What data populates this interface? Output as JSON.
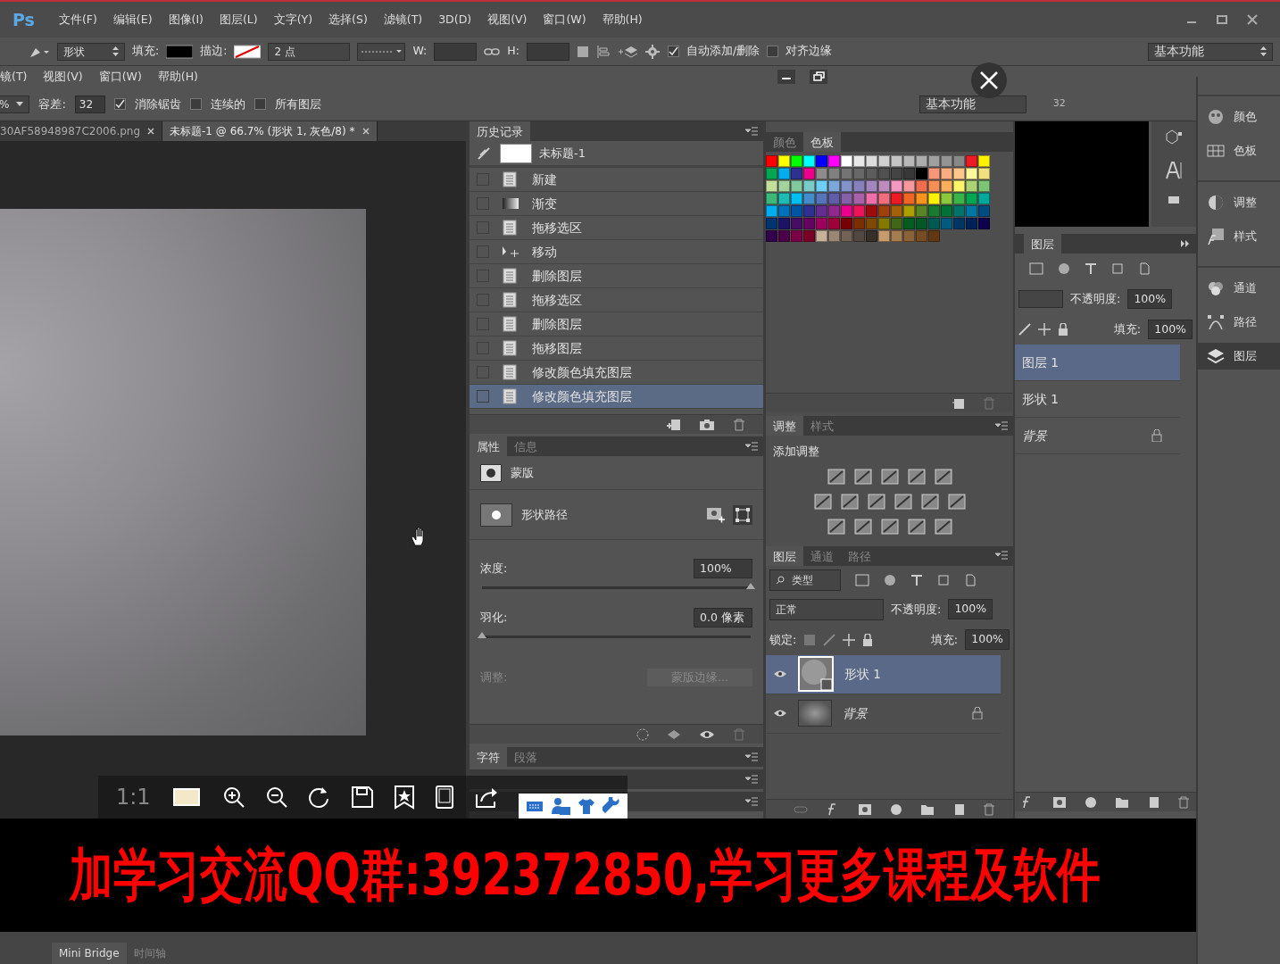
{
  "menu_bar": {
    "logo": "Ps",
    "items": [
      "文件(F)",
      "编辑(E)",
      "图像(I)",
      "图层(L)",
      "文字(Y)",
      "选择(S)",
      "滤镜(T)",
      "3D(D)",
      "视图(V)",
      "窗口(W)",
      "帮助(H)"
    ]
  },
  "options_bar": {
    "tool_mode": "形状",
    "fill_label": "填充:",
    "stroke_label": "描边:",
    "stroke_width": "2 点",
    "w_label": "W:",
    "h_label": "H:",
    "checks": [
      {
        "label": "自动添加/删除",
        "checked": true
      },
      {
        "label": "对齐边缘",
        "checked": false
      }
    ],
    "workspace": "基本功能"
  },
  "back_window": {
    "menu_items": [
      "镜(T)",
      "视图(V)",
      "窗口(W)",
      "帮助(H)"
    ],
    "zoom_value": "%",
    "tolerance_label": "容差:",
    "tolerance": "32",
    "checks": [
      {
        "label": "消除锯齿",
        "checked": true
      },
      {
        "label": "连续的",
        "checked": false
      },
      {
        "label": "所有图层",
        "checked": false
      }
    ],
    "workspace": "基本功能",
    "ruler_mark": "32"
  },
  "document_tabs": [
    {
      "label": "30AF58948987C2006.png",
      "selected": false
    },
    {
      "label": "未标题-1 @ 66.7% (形状 1, 灰色/8) *",
      "selected": true
    }
  ],
  "history": {
    "tabs": [
      {
        "label": "历史记录",
        "selected": true
      }
    ],
    "snapshot": "未标题-1",
    "items": [
      {
        "label": "新建",
        "kind": "doc",
        "selected": false
      },
      {
        "label": "渐变",
        "kind": "gradient",
        "selected": false
      },
      {
        "label": "拖移选区",
        "kind": "doc",
        "selected": false
      },
      {
        "label": "移动",
        "kind": "move",
        "selected": false
      },
      {
        "label": "删除图层",
        "kind": "doc",
        "selected": false
      },
      {
        "label": "拖移选区",
        "kind": "doc",
        "selected": false
      },
      {
        "label": "删除图层",
        "kind": "doc",
        "selected": false
      },
      {
        "label": "拖移图层",
        "kind": "doc",
        "selected": false
      },
      {
        "label": "修改颜色填充图层",
        "kind": "doc",
        "selected": false
      },
      {
        "label": "修改颜色填充图层",
        "kind": "doc",
        "selected": true
      }
    ]
  },
  "properties": {
    "tabs": [
      {
        "label": "属性",
        "selected": true
      },
      {
        "label": "信息",
        "selected": false
      }
    ],
    "mask_label": "蒙版",
    "path_label": "形状路径",
    "sliders": [
      {
        "label": "浓度:",
        "value": "100%",
        "level": 1
      },
      {
        "label": "羽化:",
        "value": "0.0 像素",
        "level": 0
      }
    ],
    "refine_label": "调整:",
    "refine_button": "蒙版边缘..."
  },
  "character_tabs": [
    {
      "label": "字符",
      "selected": true
    },
    {
      "label": "段落",
      "selected": false
    }
  ],
  "swatches": {
    "tabs": [
      {
        "label": "颜色",
        "selected": false
      },
      {
        "label": "色板",
        "selected": true
      }
    ],
    "colors": [
      {
        "color": "#ff0000"
      },
      {
        "color": "#ffff00"
      },
      {
        "color": "#00ff00"
      },
      {
        "color": "#00ffff"
      },
      {
        "color": "#0000ff"
      },
      {
        "color": "#ff00ff"
      },
      {
        "color": "#ffffff"
      },
      {
        "color": "#e8e8e8"
      },
      {
        "color": "#dcdcdc"
      },
      {
        "color": "#d0d0d0"
      },
      {
        "color": "#c4c4c4"
      },
      {
        "color": "#b8b8b8"
      },
      {
        "color": "#acacac"
      },
      {
        "color": "#a0a0a0"
      },
      {
        "color": "#949494"
      },
      {
        "color": "#888888"
      },
      {
        "color": "#ed1c24"
      },
      {
        "color": "#fff200"
      },
      {
        "color": "#00a651"
      },
      {
        "color": "#00aeef"
      },
      {
        "color": "#2e3192"
      },
      {
        "color": "#ec008c"
      },
      {
        "color": "#8c8c8c"
      },
      {
        "color": "#808080"
      },
      {
        "color": "#747474"
      },
      {
        "color": "#686868"
      },
      {
        "color": "#5c5c5c"
      },
      {
        "color": "#505050"
      },
      {
        "color": "#444444"
      },
      {
        "color": "#383838"
      },
      {
        "color": "#000000"
      },
      {
        "color": "#f7977a"
      },
      {
        "color": "#f9ad81"
      },
      {
        "color": "#fdc68a"
      },
      {
        "color": "#fff79a"
      },
      {
        "color": "#f0e080"
      },
      {
        "color": "#c4df9b"
      },
      {
        "color": "#a3d39c"
      },
      {
        "color": "#82ca9c"
      },
      {
        "color": "#7accc8"
      },
      {
        "color": "#6dcff6"
      },
      {
        "color": "#7da7d9"
      },
      {
        "color": "#8393ca"
      },
      {
        "color": "#8781bd"
      },
      {
        "color": "#a187be"
      },
      {
        "color": "#bd8cbf"
      },
      {
        "color": "#f49ac2"
      },
      {
        "color": "#f6989d"
      },
      {
        "color": "#f26c4f"
      },
      {
        "color": "#f68e56"
      },
      {
        "color": "#fbaf5d"
      },
      {
        "color": "#fff568"
      },
      {
        "color": "#acd373"
      },
      {
        "color": "#7cc576"
      },
      {
        "color": "#3cb878"
      },
      {
        "color": "#1cbbb4"
      },
      {
        "color": "#00bff3"
      },
      {
        "color": "#448ccb"
      },
      {
        "color": "#5674b9"
      },
      {
        "color": "#605ca8"
      },
      {
        "color": "#855fa8"
      },
      {
        "color": "#a863a8"
      },
      {
        "color": "#f06eaa"
      },
      {
        "color": "#f26d7d"
      },
      {
        "color": "#ed1c24"
      },
      {
        "color": "#f26522"
      },
      {
        "color": "#f7941d"
      },
      {
        "color": "#fff200"
      },
      {
        "color": "#8dc63f"
      },
      {
        "color": "#39b54a"
      },
      {
        "color": "#00a651"
      },
      {
        "color": "#00a99d"
      },
      {
        "color": "#00aeef"
      },
      {
        "color": "#0072bc"
      },
      {
        "color": "#0054a6"
      },
      {
        "color": "#2e3192"
      },
      {
        "color": "#662d91"
      },
      {
        "color": "#92278f"
      },
      {
        "color": "#ec008c"
      },
      {
        "color": "#ed145b"
      },
      {
        "color": "#9e0b0f"
      },
      {
        "color": "#a0410d"
      },
      {
        "color": "#a3620a"
      },
      {
        "color": "#aba000"
      },
      {
        "color": "#598527"
      },
      {
        "color": "#197b30"
      },
      {
        "color": "#007236"
      },
      {
        "color": "#00746b"
      },
      {
        "color": "#0076a3"
      },
      {
        "color": "#004a80"
      },
      {
        "color": "#003471"
      },
      {
        "color": "#1b1464"
      },
      {
        "color": "#440e62"
      },
      {
        "color": "#630460"
      },
      {
        "color": "#9e005d"
      },
      {
        "color": "#9e0039"
      },
      {
        "color": "#790000"
      },
      {
        "color": "#7b2e00"
      },
      {
        "color": "#7d4900"
      },
      {
        "color": "#827b00"
      },
      {
        "color": "#406618"
      },
      {
        "color": "#005e20"
      },
      {
        "color": "#005826"
      },
      {
        "color": "#005952"
      },
      {
        "color": "#005b7f"
      },
      {
        "color": "#003663"
      },
      {
        "color": "#002157"
      },
      {
        "color": "#0d004c"
      },
      {
        "color": "#32004b"
      },
      {
        "color": "#4b0049"
      },
      {
        "color": "#7b0046"
      },
      {
        "color": "#7a0026"
      },
      {
        "color": "#c7b299"
      },
      {
        "color": "#998675"
      },
      {
        "color": "#736357"
      },
      {
        "color": "#534741"
      },
      {
        "color": "#37302a"
      },
      {
        "color": "#c69c6d"
      },
      {
        "color": "#a67c52"
      },
      {
        "color": "#8c6239"
      },
      {
        "color": "#754c24"
      },
      {
        "color": "#603913"
      }
    ]
  },
  "adjustments": {
    "tabs": [
      {
        "label": "调整",
        "selected": true
      },
      {
        "label": "样式",
        "selected": false
      }
    ],
    "title": "添加调整"
  },
  "layers": {
    "tabs": [
      {
        "label": "图层",
        "selected": true
      },
      {
        "label": "通道",
        "selected": false
      },
      {
        "label": "路径",
        "selected": false
      }
    ],
    "filter": "类型",
    "blend_mode": "正常",
    "opacity_label": "不透明度:",
    "opacity": "100%",
    "lock_label": "锁定:",
    "fill_label": "填充:",
    "fill": "100%",
    "layers": [
      {
        "name": "形状 1",
        "kind": "shape",
        "visible": true,
        "selected": true,
        "locked": false
      },
      {
        "name": "背景",
        "kind": "background",
        "visible": true,
        "selected": false,
        "locked": true
      }
    ]
  },
  "layers_back": {
    "tabs": [
      {
        "label": "图层",
        "selected": true
      }
    ],
    "opacity_label": "不透明度:",
    "opacity": "100%",
    "fill_label": "填充:",
    "fill": "100%",
    "layers": [
      {
        "name": "图层 1",
        "selected": true,
        "locked": false
      },
      {
        "name": "形状 1",
        "selected": false,
        "locked": false
      },
      {
        "name": "背景",
        "selected": false,
        "locked": true
      }
    ]
  },
  "dock": {
    "items": [
      {
        "label": "颜色",
        "kind": "color",
        "selected": false
      },
      {
        "label": "色板",
        "kind": "swatches",
        "selected": false
      },
      {
        "label": "调整",
        "kind": "adjust",
        "selected": false
      },
      {
        "label": "样式",
        "kind": "style",
        "selected": false
      },
      {
        "label": "通道",
        "kind": "channels",
        "selected": false
      },
      {
        "label": "路径",
        "kind": "paths",
        "selected": false
      },
      {
        "label": "图层",
        "kind": "layers",
        "selected": true
      }
    ]
  },
  "video_toolbar": {
    "ratio": "1:1"
  },
  "caption": "加学习交流QQ群:392372850,学习更多课程及软件",
  "status_bar": {
    "tabs": [
      {
        "label": "Mini Bridge",
        "selected": true
      },
      {
        "label": "时间轴",
        "selected": false
      }
    ]
  }
}
